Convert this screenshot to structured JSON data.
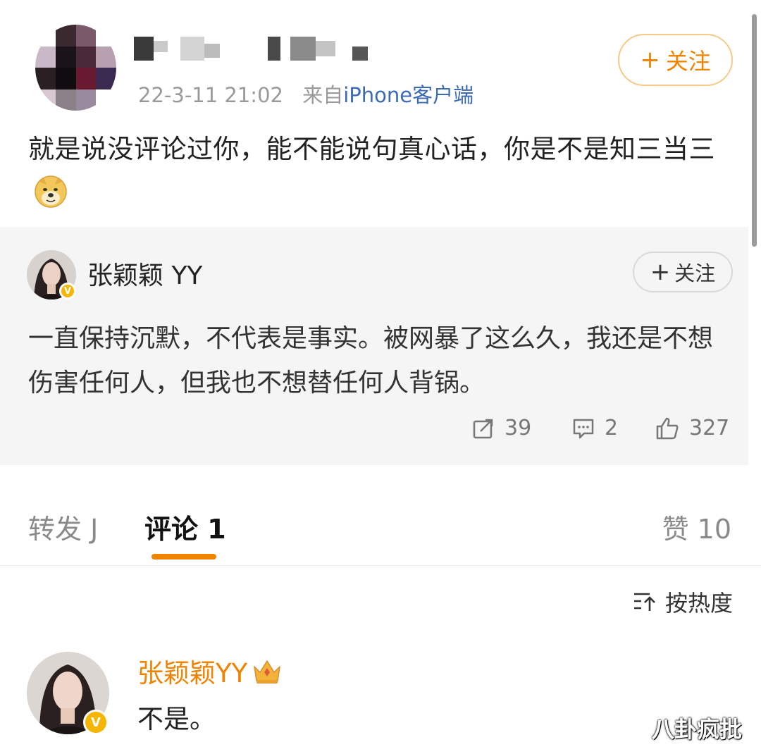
{
  "post": {
    "timestamp": "22-3-11 21:02",
    "source_prefix": "来自",
    "source_device": "iPhone客户端",
    "follow_label": "关注",
    "text": "就是说没评论过你，能不能说句真心话，你是不是知三当三",
    "emoji_icon": "doge-emoji"
  },
  "quoted": {
    "author": "张颖颖 YY",
    "follow_label": "关注",
    "text": "一直保持沉默，不代表是事实。被网暴了这么久，我还是不想伤害任何人，但我也不想替任何人背锅。",
    "repost_count": "39",
    "comment_count": "2",
    "like_count": "327"
  },
  "tabs": {
    "repost": "转发 J",
    "comment": "评论 1",
    "like": "赞 10"
  },
  "sort_label": "按热度",
  "comment": {
    "author": "张颖颖YY",
    "badge_icon": "crown-icon",
    "text": "不是。"
  },
  "watermark": "八卦疯批",
  "colors": {
    "accent": "#f08300",
    "link": "#3b6bb3",
    "quoted_bg": "#f5f5f5",
    "verified": "#f6b500"
  }
}
